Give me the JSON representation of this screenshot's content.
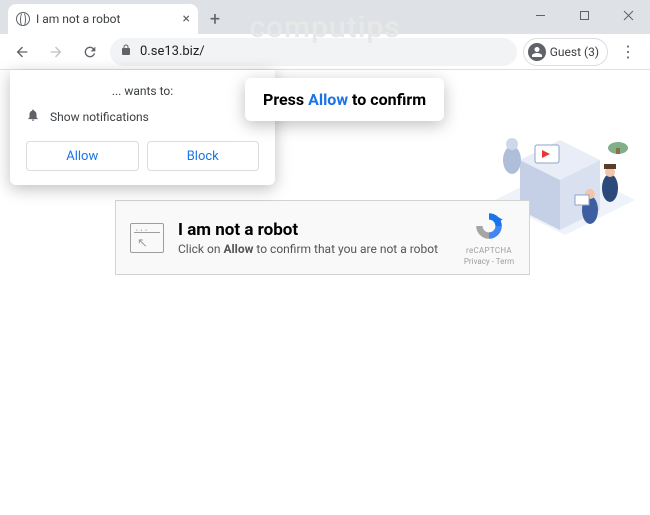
{
  "watermark": "computips",
  "tab": {
    "title": "I am not a robot"
  },
  "toolbar": {
    "url": "0.se13.biz/",
    "profile_label": "Guest (3)"
  },
  "perm": {
    "wants": "... wants to:",
    "notif": "Show notifications",
    "allow": "Allow",
    "block": "Block"
  },
  "tooltip": {
    "pre": "Press ",
    "hl": "Allow",
    "post": " to confirm"
  },
  "captcha": {
    "title": "I am not a robot",
    "sub_pre": "Click on ",
    "sub_bold": "Allow",
    "sub_post": " to confirm that you are not a robot",
    "recaptcha": "reCAPTCHA",
    "links": "Privacy - Term"
  }
}
